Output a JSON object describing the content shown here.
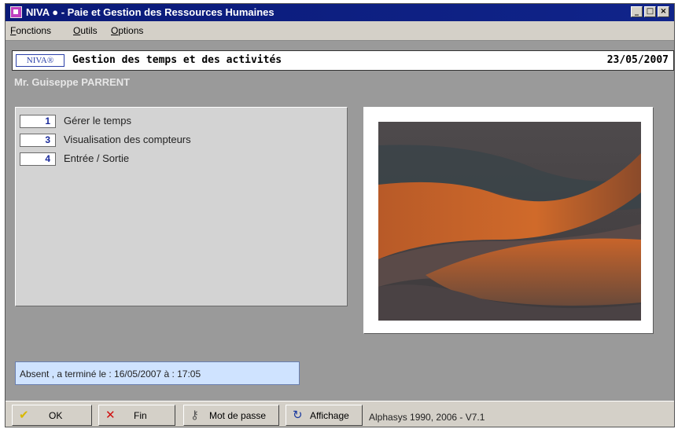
{
  "window": {
    "title": "NIVA ● - Paie et Gestion des Ressources Humaines",
    "controls": [
      "_",
      "□",
      "×"
    ]
  },
  "menubar": {
    "items": [
      "Fonctions",
      "Outils",
      "Options"
    ]
  },
  "module": {
    "logo": "NIVA®",
    "title": "Gestion des temps et des activités",
    "date": "23/05/2007"
  },
  "user": {
    "name": "Mr. Guiseppe PARRENT"
  },
  "options": [
    {
      "key": "1",
      "label": "Gérer le temps"
    },
    {
      "key": "3",
      "label": "Visualisation des compteurs"
    },
    {
      "key": "4",
      "label": "Entrée / Sortie"
    }
  ],
  "status": {
    "text": "Absent   , a terminé le :  16/05/2007  à :  17:05"
  },
  "buttons": {
    "ok": "OK",
    "fin": "Fin",
    "password": "Mot de passe",
    "display": "Affichage"
  },
  "icons": {
    "ok": "check-icon",
    "fin": "close-x-icon",
    "password": "key-person-icon",
    "display": "display-arrow-icon"
  },
  "footer": {
    "version": "Alphasys 1990, 2006 - V7.1"
  },
  "colors": {
    "titlebar": "#0a1a78",
    "panel": "#d3d3d3",
    "status_bg": "#cfe3ff",
    "dune_orange": "#c0602a",
    "ok_check": "#d8b800",
    "fin_x": "#d01010"
  }
}
